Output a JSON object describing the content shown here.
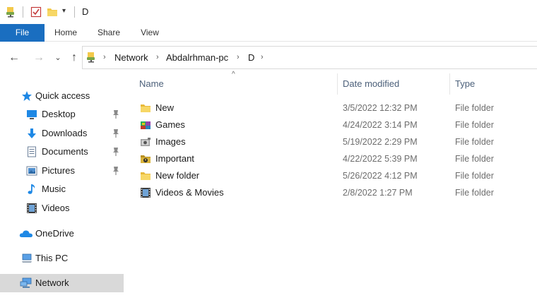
{
  "window": {
    "title": "D"
  },
  "ribbon": {
    "tabs": [
      {
        "label": "File"
      },
      {
        "label": "Home"
      },
      {
        "label": "Share"
      },
      {
        "label": "View"
      }
    ]
  },
  "address": {
    "crumbs": [
      {
        "label": "Network"
      },
      {
        "label": "Abdalrhman-pc"
      },
      {
        "label": "D"
      }
    ]
  },
  "nav": {
    "quick_access": "Quick access",
    "items": [
      {
        "label": "Desktop",
        "icon": "desktop-icon",
        "pinned": true
      },
      {
        "label": "Downloads",
        "icon": "downloads-icon",
        "pinned": true
      },
      {
        "label": "Documents",
        "icon": "documents-icon",
        "pinned": true
      },
      {
        "label": "Pictures",
        "icon": "pictures-icon",
        "pinned": true
      },
      {
        "label": "Music",
        "icon": "music-icon",
        "pinned": false
      },
      {
        "label": "Videos",
        "icon": "videos-icon",
        "pinned": false
      }
    ],
    "onedrive": "OneDrive",
    "this_pc": "This PC",
    "network": "Network",
    "selected": "Network"
  },
  "columns": {
    "name": "Name",
    "date": "Date modified",
    "type": "Type"
  },
  "files": [
    {
      "name": "New",
      "date": "3/5/2022 12:32 PM",
      "type": "File folder",
      "icon": "folder-icon"
    },
    {
      "name": "Games",
      "date": "4/24/2022 3:14 PM",
      "type": "File folder",
      "icon": "games-folder-icon"
    },
    {
      "name": "Images",
      "date": "5/19/2022 2:29 PM",
      "type": "File folder",
      "icon": "images-folder-icon"
    },
    {
      "name": "Important",
      "date": "4/22/2022 5:39 PM",
      "type": "File folder",
      "icon": "important-folder-icon"
    },
    {
      "name": "New folder",
      "date": "5/26/2022 4:12 PM",
      "type": "File folder",
      "icon": "folder-icon"
    },
    {
      "name": "Videos & Movies",
      "date": "2/8/2022 1:27 PM",
      "type": "File folder",
      "icon": "videos-folder-icon"
    }
  ],
  "colors": {
    "file_tab": "#1a6ec0",
    "folder": "#f3c94a",
    "selected_nav": "#d9d9d9",
    "accent_blue": "#1e88e5"
  }
}
